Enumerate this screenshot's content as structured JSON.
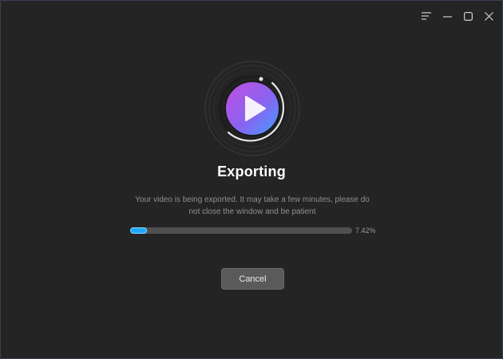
{
  "window": {
    "controls": [
      {
        "name": "menu-icon"
      },
      {
        "name": "minimize-icon"
      },
      {
        "name": "maximize-icon"
      },
      {
        "name": "close-icon"
      }
    ]
  },
  "dialog": {
    "hero_icon": "play-icon",
    "title": "Exporting",
    "description": "Your video is being exported. It may take a few minutes, please do not close the window and be patient",
    "progress": {
      "fraction": 0.0742,
      "label": "7.42%",
      "color": "#1da8ff"
    },
    "cancel_label": "Cancel"
  },
  "colors": {
    "background": "#242424",
    "accent": "#1da8ff",
    "play_gradient_start": "#b44be0",
    "play_gradient_end": "#3f8dff"
  }
}
